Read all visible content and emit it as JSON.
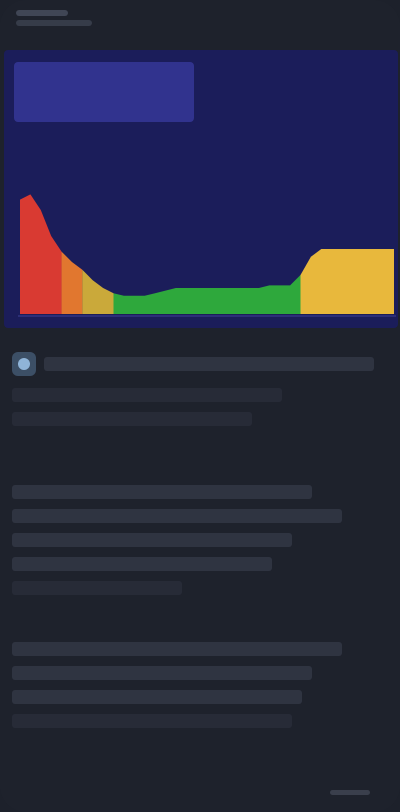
{
  "status_bar": {
    "time": "",
    "carrier": ""
  },
  "summary_card": {
    "left_title": "",
    "left_subtitle": "",
    "right_title": "",
    "right_value": ""
  },
  "chart_data": {
    "type": "area",
    "x": [
      0,
      1,
      2,
      3,
      4,
      5,
      6,
      7,
      8,
      9,
      10,
      11,
      12,
      13,
      14,
      15,
      16,
      17,
      18,
      19,
      20,
      21,
      22,
      23,
      24,
      25,
      26,
      27,
      28,
      29,
      30,
      31,
      32,
      33,
      34,
      35,
      36
    ],
    "values": [
      88,
      92,
      80,
      60,
      48,
      40,
      34,
      26,
      20,
      16,
      14,
      14,
      14,
      16,
      18,
      20,
      20,
      20,
      20,
      20,
      20,
      20,
      20,
      20,
      22,
      22,
      22,
      30,
      44,
      50,
      50,
      50,
      50,
      50,
      50,
      50,
      50
    ],
    "colors": [
      "#d93a32",
      "#e1732f",
      "#d9b437",
      "#2aa43a",
      "#2aa43a",
      "#2aa43a",
      "#2aa43a",
      "#e6b63a"
    ],
    "segments": [
      {
        "from": 0,
        "to": 4,
        "color": "#d93a32"
      },
      {
        "from": 4,
        "to": 6,
        "color": "#e1772f"
      },
      {
        "from": 6,
        "to": 9,
        "color": "#caa93a"
      },
      {
        "from": 9,
        "to": 27,
        "color": "#2ea83c"
      },
      {
        "from": 27,
        "to": 36,
        "color": "#e8b83c"
      }
    ],
    "ylim": [
      0,
      100
    ],
    "grid": false,
    "title": "",
    "xlabel": "",
    "ylabel": ""
  },
  "content": {
    "section1": [
      "",
      "",
      ""
    ],
    "section2": [
      "",
      "",
      "",
      "",
      ""
    ],
    "section3": [
      "",
      "",
      "",
      ""
    ]
  },
  "colors": {
    "background": "#1e222c",
    "card": "#1b1d5a",
    "accent_red": "#d93a32",
    "accent_green": "#2ea83c",
    "accent_yellow": "#e8b83c"
  }
}
